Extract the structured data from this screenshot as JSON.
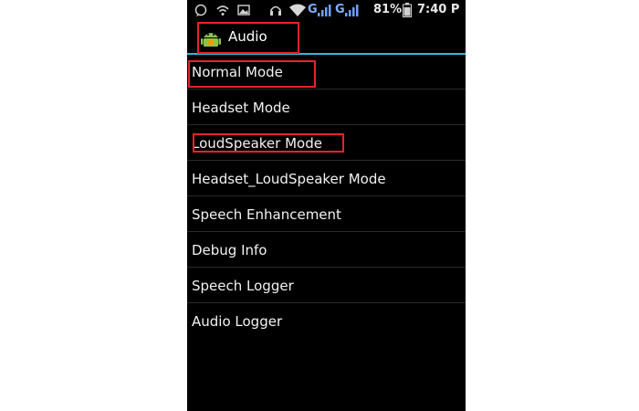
{
  "status_bar": {
    "network_type_1": "G",
    "network_type_2": "G",
    "battery_percent": "81%",
    "time": "7:40 P"
  },
  "action_bar": {
    "title": "Audio",
    "icon": "android-robot-icon"
  },
  "menu": {
    "items": [
      {
        "label": "Normal Mode"
      },
      {
        "label": "Headset Mode"
      },
      {
        "label": "LoudSpeaker Mode"
      },
      {
        "label": "Headset_LoudSpeaker Mode"
      },
      {
        "label": "Speech Enhancement"
      },
      {
        "label": "Debug Info"
      },
      {
        "label": "Speech Logger"
      },
      {
        "label": "Audio Logger"
      }
    ]
  },
  "annotations": {
    "highlight_color": "#e8232b",
    "accent_color": "#33b5e5"
  }
}
